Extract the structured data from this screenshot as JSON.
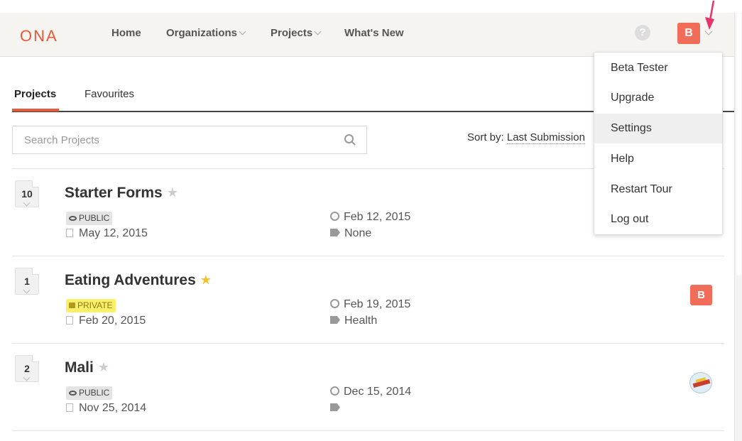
{
  "header": {
    "logo": "ONA",
    "nav": [
      {
        "label": "Home"
      },
      {
        "label": "Organizations"
      },
      {
        "label": "Projects"
      },
      {
        "label": "What's New"
      }
    ],
    "help_glyph": "?",
    "user_initial": "B"
  },
  "tabs": [
    {
      "label": "Projects"
    },
    {
      "label": "Favourites"
    }
  ],
  "search": {
    "placeholder": "Search Projects"
  },
  "sort": {
    "label": "Sort by:",
    "value": "Last Submission"
  },
  "projects": [
    {
      "count": "10",
      "title": "Starter Forms",
      "favourite": false,
      "visibility": "PUBLIC",
      "created": "May 12, 2015",
      "last_submission": "Feb 12, 2015",
      "tags": "None",
      "collaborator": ""
    },
    {
      "count": "1",
      "title": "Eating Adventures",
      "favourite": true,
      "visibility": "PRIVATE",
      "created": "Feb 20, 2015",
      "last_submission": "Feb 19, 2015",
      "tags": "Health",
      "collaborator": "B"
    },
    {
      "count": "2",
      "title": "Mali",
      "favourite": false,
      "visibility": "PUBLIC",
      "created": "Nov 25, 2014",
      "last_submission": "Dec 15, 2014",
      "tags": "",
      "collaborator": "image"
    }
  ],
  "user_menu": [
    {
      "label": "Beta Tester"
    },
    {
      "label": "Upgrade"
    },
    {
      "label": "Settings"
    },
    {
      "label": "Help"
    },
    {
      "label": "Restart Tour"
    },
    {
      "label": "Log out"
    }
  ],
  "colors": {
    "accent": "#e8593a",
    "avatar": "#f16d5a",
    "private_badge": "#fbf06b",
    "star_fav": "#f2c12e"
  },
  "icons": [
    "question-icon",
    "search-icon",
    "eye-icon",
    "lock-icon",
    "star-icon",
    "clock-icon",
    "tag-icon",
    "file-icon",
    "arrow-pointer-icon"
  ]
}
